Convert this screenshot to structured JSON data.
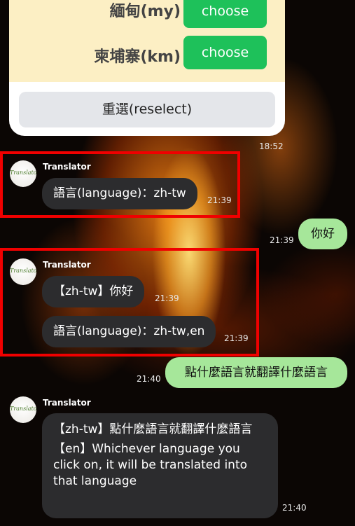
{
  "picker": {
    "rows": [
      {
        "label": "緬甸(my)",
        "button": "choose"
      },
      {
        "label": "柬埔寨(km)",
        "button": "choose"
      }
    ],
    "reselect_label": "重選(reselect)",
    "time": "18:52"
  },
  "messages": [
    {
      "sender": "Translator",
      "avatar_text": "Translator",
      "text": "語言(language)：zh-tw",
      "time": "21:39"
    },
    {
      "outgoing": true,
      "text": "你好",
      "time": "21:39"
    },
    {
      "sender": "Translator",
      "avatar_text": "Translator",
      "text": "【zh-tw】你好",
      "time": "21:39"
    },
    {
      "text": "語言(language)：zh-tw,en",
      "time": "21:39"
    },
    {
      "outgoing": true,
      "text": "點什麼語言就翻譯什麼語言",
      "time": "21:40"
    },
    {
      "sender": "Translator",
      "avatar_text": "Translator",
      "zh_text": "【zh-tw】點什麼語言就翻譯什麼語言",
      "en_text": "【en】Whichever language you click on, it will be translated into that language",
      "time": "21:40"
    }
  ],
  "colors": {
    "choose_button": "#1ec15a",
    "picker_rows_bg": "#fcefc4",
    "incoming_bubble": "#2c2c2e",
    "outgoing_bubble": "#a6e79a",
    "highlight_box": "#f00000"
  }
}
